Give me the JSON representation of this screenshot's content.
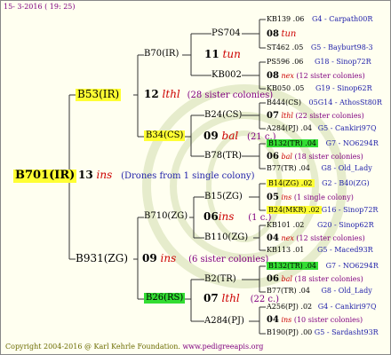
{
  "header": {
    "date": "15- 3-2016 ( 19: 25)"
  },
  "footer": {
    "copyright": "Copyright 2004-2016 @ Karl Kehrle Foundation.",
    "url": "www.pedigreeapis.org"
  },
  "colors": {
    "text_red": "#cc0000",
    "text_blue": "#2222aa",
    "text_purple": "#800080",
    "highlight_yellow": "#ffff33",
    "highlight_green": "#33dd33"
  },
  "root": {
    "name": "B701(IR)",
    "num": "13",
    "tag": "ins",
    "note": "(Drones from 1 single colony)"
  },
  "gen1": {
    "top": {
      "name": "B53(IR)",
      "num": "12",
      "tag": "lthl",
      "note": "(28 sister colonies)"
    },
    "bot": {
      "name": "B931(ZG)",
      "num": "09",
      "tag": "ins",
      "note": "(6 sister colonies)"
    }
  },
  "gen2": {
    "b70": {
      "name": "B70(IR)",
      "num": "11",
      "tag": "tun"
    },
    "b34": {
      "name": "B34(CS)",
      "num": "09",
      "tag": "bal",
      "note": "(21 c.)"
    },
    "b710": {
      "name": "B710(ZG)",
      "num": "06",
      "tag": "ins",
      "note": "(1 c.)"
    },
    "b26": {
      "name": "B26(RS)",
      "num": "07",
      "tag": "lthl",
      "note": "(22 c.)"
    }
  },
  "gen3": {
    "ps704": "PS704",
    "kb002": "KB002",
    "b24": "B24(CS)",
    "b78": "B78(TR)",
    "b15": "B15(ZG)",
    "b110": "B110(ZG)",
    "b2": "B2(TR)",
    "a284": "A284(PJ)"
  },
  "gen4": [
    {
      "name": "KB139 .06",
      "src": "G4 - Carpath00R"
    },
    {
      "num": "08",
      "tag": "tun",
      "note": ""
    },
    {
      "name": "ST462 .05",
      "src": "G5 - Bayburt98-3"
    },
    {
      "name": "PS596 .06",
      "src": "G18 - Sinop72R"
    },
    {
      "num": "08",
      "tag": "nex",
      "note": "(12 sister colonies)"
    },
    {
      "name": "KB050 .05",
      "src": "G19 - Sinop62R"
    },
    {
      "name": "B444(CS)",
      "src": "05G14 - AthosSt80R"
    },
    {
      "num": "07",
      "tag": "lthl",
      "note": "(22 sister colonies)"
    },
    {
      "name": "A284(PJ) .04",
      "src": "G5 - Cankiri97Q"
    },
    {
      "name": "B132(TR) .04",
      "src": "G7 - NO6294R"
    },
    {
      "num": "06",
      "tag": "bal",
      "note": "(18 sister colonies)"
    },
    {
      "name": "B77(TR) .04",
      "src": "G8 - Old_Lady"
    },
    {
      "name": "B14(ZG) .02",
      "src": "G2 - B40(ZG)"
    },
    {
      "num": "05",
      "tag": "ins",
      "note": "(1 single colony)"
    },
    {
      "name": "B24(MKR) .02",
      "src": "G16 - Sinop72R"
    },
    {
      "name": "KB101 .02",
      "src": "G20 - Sinop62R"
    },
    {
      "num": "04",
      "tag": "nex",
      "note": "(12 sister colonies)"
    },
    {
      "name": "KB113 .01",
      "src": "G5 - Maced93R"
    },
    {
      "name": "B132(TR) .04",
      "src": "G7 - NO6294R"
    },
    {
      "num": "06",
      "tag": "bal",
      "note": "(18 sister colonies)"
    },
    {
      "name": "B77(TR) .04",
      "src": "G8 - Old_Lady"
    },
    {
      "name": "A256(PJ) .02",
      "src": "G4 - Cankiri97Q"
    },
    {
      "num": "04",
      "tag": "ins",
      "note": "(10 sister colonies)"
    },
    {
      "name": "B190(PJ) .00",
      "src": "G5 - Sardasht93R"
    }
  ]
}
